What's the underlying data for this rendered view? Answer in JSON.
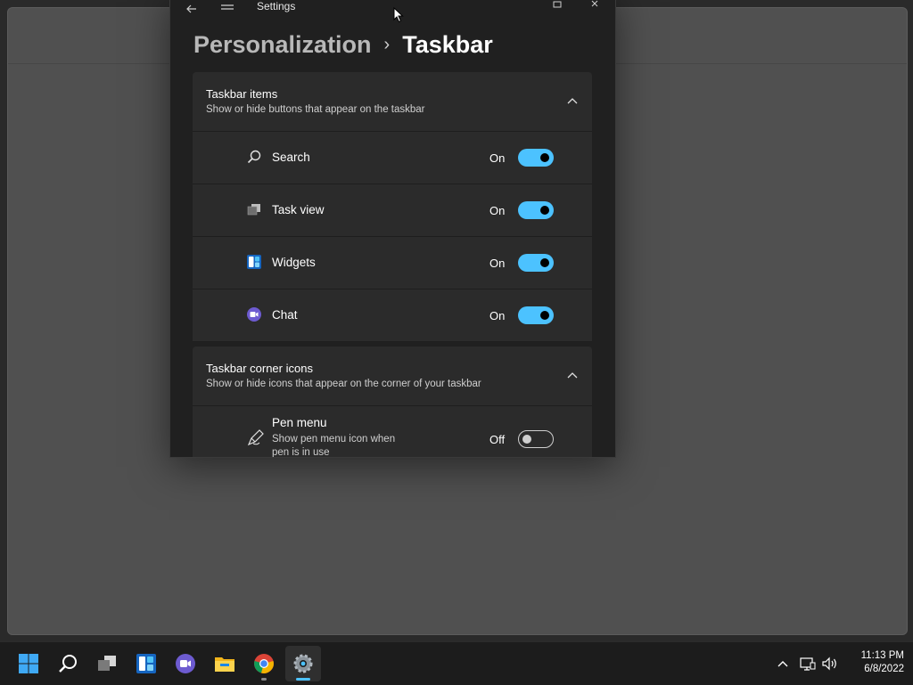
{
  "window": {
    "title": "Settings"
  },
  "breadcrumb": {
    "parent": "Personalization",
    "separator": "›",
    "current": "Taskbar"
  },
  "sections": {
    "taskbar_items": {
      "title": "Taskbar items",
      "subtitle": "Show or hide buttons that appear on the taskbar",
      "items": [
        {
          "label": "Search",
          "state": "On",
          "icon": "search-icon",
          "enabled": true
        },
        {
          "label": "Task view",
          "state": "On",
          "icon": "task-view-icon",
          "enabled": true
        },
        {
          "label": "Widgets",
          "state": "On",
          "icon": "widgets-icon",
          "enabled": true
        },
        {
          "label": "Chat",
          "state": "On",
          "icon": "chat-icon",
          "enabled": true
        }
      ]
    },
    "corner_icons": {
      "title": "Taskbar corner icons",
      "subtitle": "Show or hide icons that appear on the corner of your taskbar",
      "items": [
        {
          "label": "Pen menu",
          "description": "Show pen menu icon when pen is in use",
          "state": "Off",
          "icon": "pen-icon",
          "enabled": false
        }
      ]
    }
  },
  "taskbar": {
    "apps": [
      "start-icon",
      "search-icon",
      "task-view-icon",
      "widgets-icon",
      "chat-icon",
      "file-explorer-icon",
      "chrome-icon",
      "settings-icon"
    ],
    "active_app": "settings-icon",
    "clock": {
      "time": "11:13 PM",
      "date": "6/8/2022"
    }
  },
  "colors": {
    "accent": "#4cc2ff",
    "background": "#202020",
    "card": "#2b2b2b"
  }
}
